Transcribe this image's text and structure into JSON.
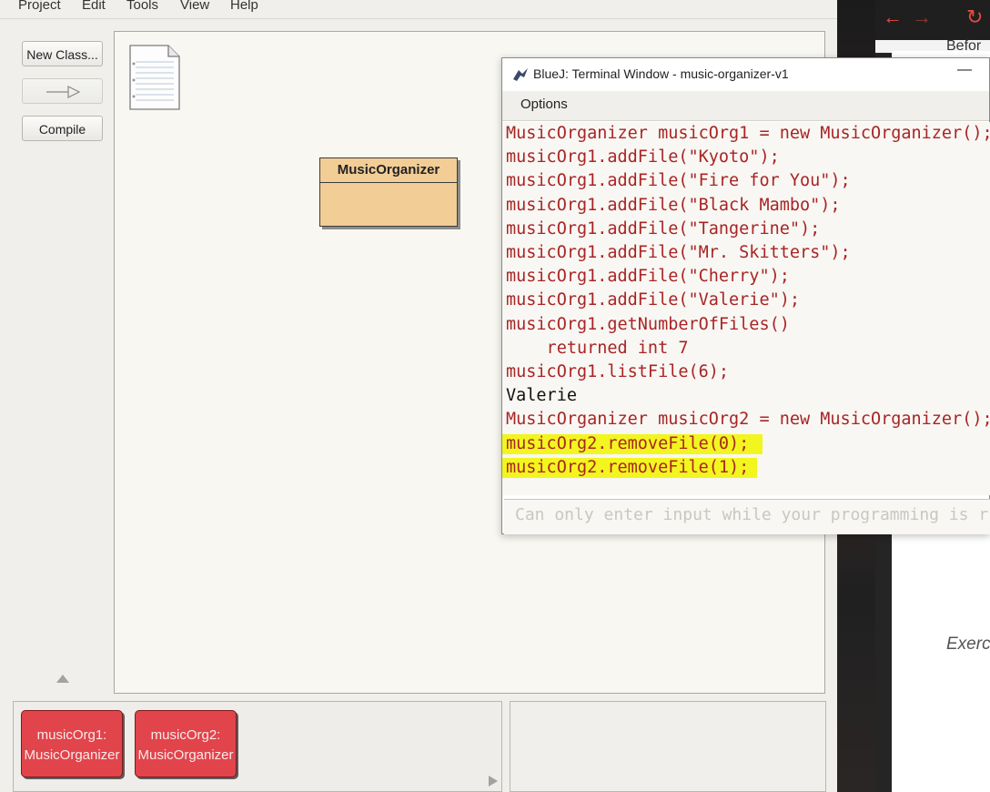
{
  "menu": {
    "items": [
      "Project",
      "Edit",
      "Tools",
      "View",
      "Help"
    ]
  },
  "toolbar": {
    "new_class_label": "New Class...",
    "arrow_icon": "inheritance-arrow-icon",
    "compile_label": "Compile"
  },
  "diagram": {
    "readme_icon": "readme-document-icon",
    "classes": [
      {
        "name": "MusicOrganizer"
      }
    ]
  },
  "object_bench": {
    "objects": [
      {
        "name": "musicOrg1:",
        "type": "MusicOrganizer",
        "color": "#e1444b"
      },
      {
        "name": "musicOrg2:",
        "type": "MusicOrganizer",
        "color": "#e1444b"
      }
    ]
  },
  "terminal": {
    "title": "BlueJ: Terminal Window - music-organizer-v1",
    "menu_label": "Options",
    "minimize_glyph": "—",
    "lines": [
      {
        "text": "MusicOrganizer musicOrg1 = new MusicOrganizer();",
        "kind": "command"
      },
      {
        "text": "musicOrg1.addFile(\"Kyoto\");",
        "kind": "command"
      },
      {
        "text": "musicOrg1.addFile(\"Fire for You\");",
        "kind": "command"
      },
      {
        "text": "musicOrg1.addFile(\"Black Mambo\");",
        "kind": "command"
      },
      {
        "text": "musicOrg1.addFile(\"Tangerine\");",
        "kind": "command"
      },
      {
        "text": "musicOrg1.addFile(\"Mr. Skitters\");",
        "kind": "command"
      },
      {
        "text": "musicOrg1.addFile(\"Cherry\");",
        "kind": "command"
      },
      {
        "text": "musicOrg1.addFile(\"Valerie\");",
        "kind": "command"
      },
      {
        "text": "musicOrg1.getNumberOfFiles()",
        "kind": "command"
      },
      {
        "text": "    returned int 7",
        "kind": "command"
      },
      {
        "text": "musicOrg1.listFile(6);",
        "kind": "command"
      },
      {
        "text": "Valerie",
        "kind": "output"
      },
      {
        "text": "MusicOrganizer musicOrg2 = new MusicOrganizer();",
        "kind": "command"
      },
      {
        "text": "musicOrg2.removeFile(0);",
        "kind": "command",
        "highlighted": true
      },
      {
        "text": "musicOrg2.removeFile(1);",
        "kind": "command",
        "highlighted": true
      }
    ],
    "input_placeholder": "Can only enter input while your programming is r",
    "highlight_color": "#f3f51f",
    "command_color": "#a82525"
  },
  "browser": {
    "nav_icons": [
      "back-arrow-icon",
      "forward-arrow-icon",
      "reload-icon"
    ],
    "tab_text_fragment": "Befor",
    "page_text_fragment": "Exerc"
  }
}
